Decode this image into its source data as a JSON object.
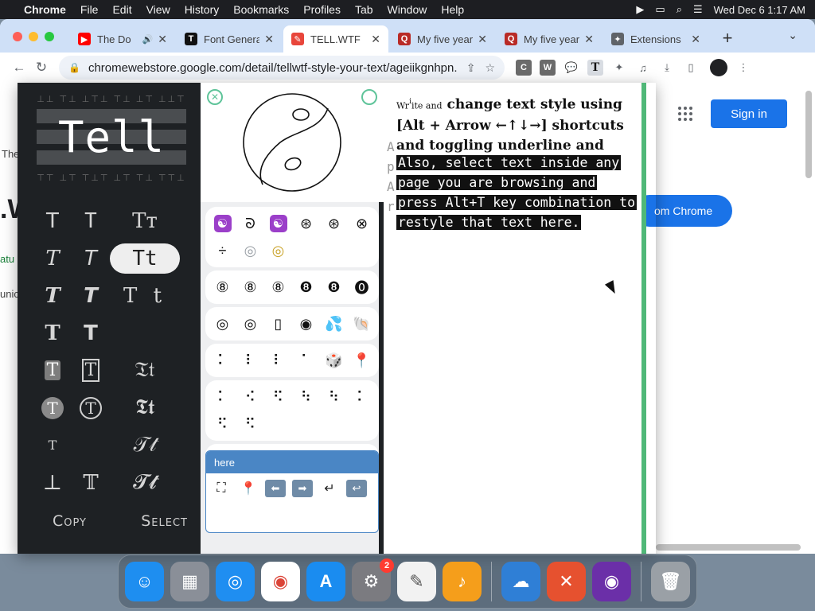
{
  "menubar": {
    "app": "Chrome",
    "items": [
      "File",
      "Edit",
      "View",
      "History",
      "Bookmarks",
      "Profiles",
      "Tab",
      "Window",
      "Help"
    ],
    "clock": "Wed Dec 6  1:17 AM"
  },
  "tabs": [
    {
      "title": "The Do",
      "favicon": "youtube-icon",
      "color": "#ff0000",
      "audio": true
    },
    {
      "title": "Font Generator",
      "favicon": "font-generator-icon",
      "color": "#111111",
      "audio": false
    },
    {
      "title": "TELL.WTF",
      "favicon": "tellwtf-icon",
      "color": "#e8463b",
      "audio": false,
      "active": true
    },
    {
      "title": "My five years",
      "favicon": "quora-icon",
      "color": "#b92b27",
      "audio": false
    },
    {
      "title": "My five years",
      "favicon": "quora-icon",
      "color": "#b92b27",
      "audio": false
    },
    {
      "title": "Extensions",
      "favicon": "puzzle-icon",
      "color": "#5f6368",
      "audio": false
    }
  ],
  "address": {
    "url": "chromewebstore.google.com/detail/tellwtf-style-your-text/ageiikgnhpn..."
  },
  "store": {
    "signin": "Sign in",
    "add_button": "om Chrome",
    "left_fragments": [
      "The",
      ".W",
      "atu",
      "unic"
    ]
  },
  "extension": {
    "logo_text": "Tell",
    "style_rows": [
      [
        "T",
        "T",
        "Tт"
      ],
      [
        "T",
        "T",
        "Tt"
      ],
      [
        "T",
        "T",
        "T t"
      ],
      [
        "T",
        "T",
        ""
      ],
      [
        "T",
        "T",
        "𝔗𝔱"
      ],
      [
        "T",
        "T",
        "𝕿𝖙"
      ],
      [
        "T",
        "",
        "𝒯𝓉"
      ],
      [
        "⊥",
        "𝕋",
        "𝓣𝓽"
      ]
    ],
    "copy_label": "Copy",
    "select_label": "Select",
    "symbol_rows": [
      [
        "☯",
        "ᘐ",
        "☯",
        "⊛",
        "⊛",
        "⊗",
        "÷",
        "◎",
        "◎"
      ],
      [
        "⑧",
        "⑧",
        "⑧",
        "❽",
        "❽",
        "⓿"
      ],
      [
        "◎",
        "◎",
        "▯",
        "◉",
        "💦",
        "🐚"
      ],
      [
        "⠅",
        "⠇",
        "⠇",
        "⠁",
        "🎲",
        "📍"
      ],
      [
        "⠅",
        "⠪",
        "⠫",
        "⠳",
        "⠳",
        "⠅",
        "⠫",
        "⠫"
      ],
      [
        "⁝",
        "🟡",
        "🔵",
        "🎱"
      ]
    ],
    "emoji_header": "here",
    "emoji_row": [
      "⛶",
      "📍",
      "⬅",
      "➡",
      "↵",
      "↩"
    ],
    "styled_intro_small": "Wr",
    "styled_intro_small2": "ite and",
    "styled_text": "change text style using [Alt + Arrow ←↑↓→] shortcuts and toggling underline and stuff.",
    "highlight_text": "Also, select text inside any page you are browsing and press Alt+T key combination to restyle that text here.",
    "ghost_text": "A\np\nA\nr"
  },
  "dock": [
    {
      "name": "finder-icon",
      "label": "Finder",
      "color": "#1e8ef0"
    },
    {
      "name": "launchpad-icon",
      "label": "Launchpad",
      "color": "#8a8f98"
    },
    {
      "name": "safari-icon",
      "label": "Safari",
      "color": "#1f8ef1"
    },
    {
      "name": "chrome-icon",
      "label": "Chrome",
      "color": "#ffffff"
    },
    {
      "name": "app-store-icon",
      "label": "App Store",
      "color": "#1a8cf0"
    },
    {
      "name": "system-settings-icon",
      "label": "System Settings",
      "color": "#7b7b80",
      "badge": "2"
    },
    {
      "name": "textedit-icon",
      "label": "TextEdit",
      "color": "#f2f2f2"
    },
    {
      "name": "garageband-icon",
      "label": "GarageBand",
      "color": "#f59e1b"
    },
    {
      "name": "weather-icon",
      "label": "Weather",
      "color": "#2f7fd6"
    },
    {
      "name": "remote-desktop-icon",
      "label": "Remote",
      "color": "#e6512f"
    },
    {
      "name": "tor-icon",
      "label": "Tor",
      "color": "#6b2fa8"
    },
    {
      "name": "trash-icon",
      "label": "Trash",
      "color": "#9aa0a6"
    }
  ]
}
